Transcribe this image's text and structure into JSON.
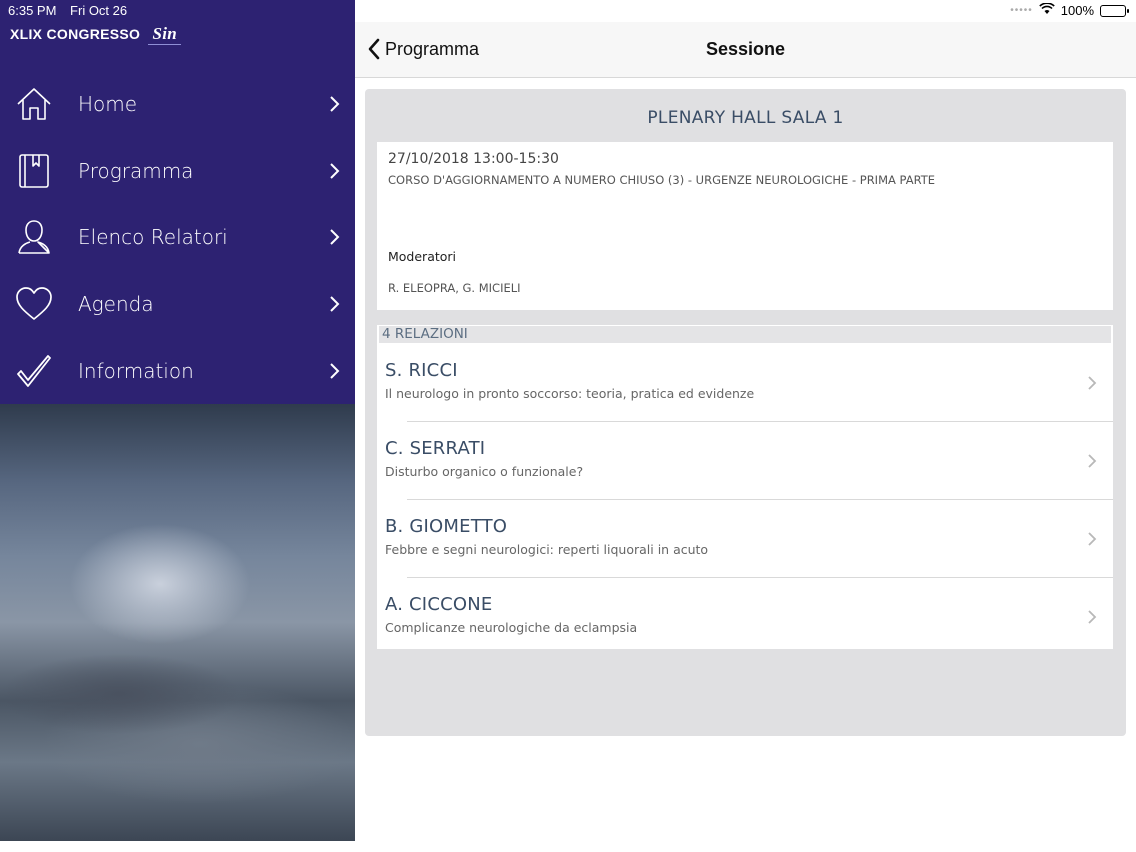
{
  "status": {
    "time": "6:35 PM",
    "date": "Fri Oct 26",
    "battery": "100%",
    "battery_level": 1.0
  },
  "brand": {
    "title": "XLIX CONGRESSO",
    "logo": "Sin"
  },
  "sidebar": {
    "items": [
      {
        "label": "Home",
        "icon": "home-icon"
      },
      {
        "label": "Programma",
        "icon": "book-icon"
      },
      {
        "label": "Elenco Relatori",
        "icon": "person-icon"
      },
      {
        "label": "Agenda",
        "icon": "heart-icon"
      },
      {
        "label": "Information",
        "icon": "check-icon"
      }
    ]
  },
  "navbar": {
    "back_label": "Programma",
    "title": "Sessione"
  },
  "session": {
    "hall": "PLENARY HALL SALA 1",
    "datetime": "27/10/2018 13:00-15:30",
    "title": "CORSO D'AGGIORNAMENTO A NUMERO CHIUSO (3) - URGENZE NEUROLOGICHE - PRIMA PARTE",
    "moderators_label": "Moderatori",
    "moderators": "R. ELEOPRA, G. MICIELI"
  },
  "relazioni": {
    "header": "4 RELAZIONI",
    "items": [
      {
        "name": "S. RICCI",
        "topic": "Il neurologo in pronto soccorso: teoria, pratica ed evidenze"
      },
      {
        "name": "C. SERRATI",
        "topic": "Disturbo organico o funzionale?"
      },
      {
        "name": "B. GIOMETTO",
        "topic": "Febbre e segni neurologici: reperti liquorali in acuto"
      },
      {
        "name": "A. CICCONE",
        "topic": "Complicanze neurologiche da eclampsia"
      }
    ]
  },
  "colors": {
    "sidebar_bg": "#2d2272",
    "accent_text": "#3a4d66"
  }
}
